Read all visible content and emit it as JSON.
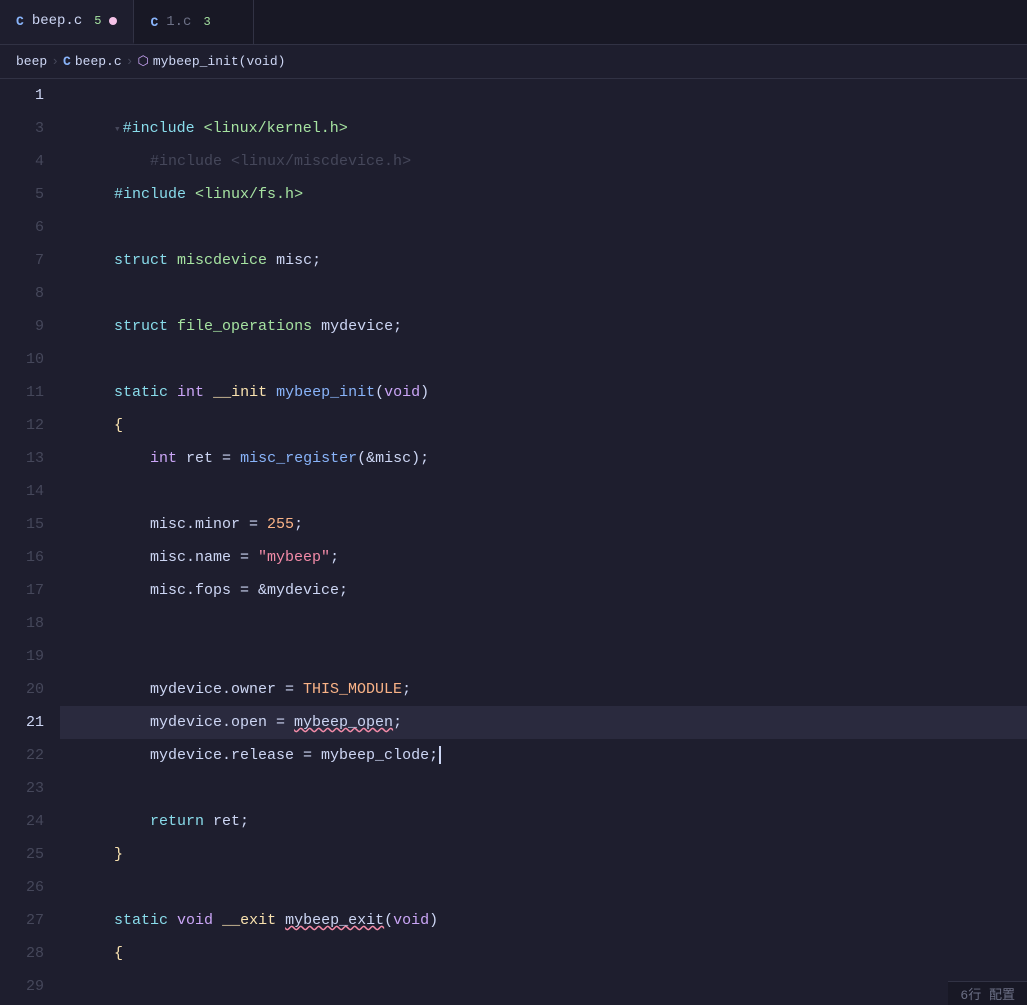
{
  "tabs": [
    {
      "id": "tab-beepc",
      "icon": "C",
      "label": "beep.c",
      "badge": "5",
      "dot": true,
      "active": true
    },
    {
      "id": "tab-1c",
      "icon": "C",
      "label": "1.c",
      "badge": "3",
      "dot": false,
      "active": false
    }
  ],
  "breadcrumb": {
    "parts": [
      "beep",
      ">",
      "C beep.c",
      ">",
      "mybeep_init(void)"
    ]
  },
  "lines": [
    {
      "num": 1,
      "fold": true,
      "content": ""
    },
    {
      "num": 3,
      "content": ""
    },
    {
      "num": 4,
      "content": ""
    },
    {
      "num": 5,
      "content": ""
    },
    {
      "num": 6,
      "content": ""
    },
    {
      "num": 7,
      "content": ""
    },
    {
      "num": 8,
      "content": ""
    },
    {
      "num": 9,
      "content": ""
    },
    {
      "num": 10,
      "content": ""
    },
    {
      "num": 11,
      "content": ""
    },
    {
      "num": 12,
      "content": ""
    },
    {
      "num": 13,
      "content": ""
    },
    {
      "num": 14,
      "content": ""
    },
    {
      "num": 15,
      "content": ""
    },
    {
      "num": 16,
      "content": ""
    },
    {
      "num": 17,
      "content": ""
    },
    {
      "num": 18,
      "content": ""
    },
    {
      "num": 19,
      "content": ""
    },
    {
      "num": 20,
      "content": ""
    },
    {
      "num": 21,
      "content": "",
      "active": true
    },
    {
      "num": 22,
      "content": ""
    },
    {
      "num": 23,
      "content": ""
    },
    {
      "num": 24,
      "content": ""
    },
    {
      "num": 25,
      "content": ""
    },
    {
      "num": 26,
      "content": ""
    },
    {
      "num": 27,
      "content": ""
    },
    {
      "num": 28,
      "content": ""
    },
    {
      "num": 29,
      "content": ""
    }
  ],
  "status": {
    "position": "6行  配置"
  }
}
